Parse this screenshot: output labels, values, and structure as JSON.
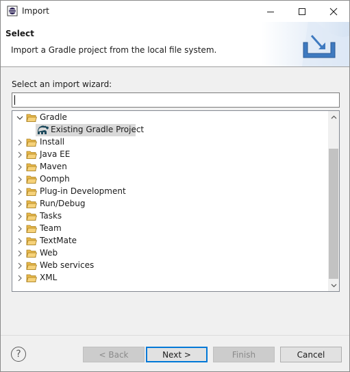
{
  "window": {
    "title": "Import"
  },
  "banner": {
    "title": "Select",
    "description": "Import a Gradle project from the local file system."
  },
  "wizard": {
    "prompt": "Select an import wizard:",
    "filter_value": "",
    "tree": [
      {
        "label": "Gradle",
        "expanded": true,
        "children": [
          {
            "label": "Existing Gradle Project",
            "selected": true
          }
        ]
      },
      {
        "label": "Install",
        "expanded": false
      },
      {
        "label": "Java EE",
        "expanded": false
      },
      {
        "label": "Maven",
        "expanded": false
      },
      {
        "label": "Oomph",
        "expanded": false
      },
      {
        "label": "Plug-in Development",
        "expanded": false
      },
      {
        "label": "Run/Debug",
        "expanded": false
      },
      {
        "label": "Tasks",
        "expanded": false
      },
      {
        "label": "Team",
        "expanded": false
      },
      {
        "label": "TextMate",
        "expanded": false
      },
      {
        "label": "Web",
        "expanded": false
      },
      {
        "label": "Web services",
        "expanded": false
      },
      {
        "label": "XML",
        "expanded": false
      }
    ]
  },
  "footer": {
    "help_symbol": "?",
    "back_label": "< Back",
    "next_label": "Next >",
    "finish_label": "Finish",
    "cancel_label": "Cancel"
  },
  "colors": {
    "folder": "#e8b84a",
    "accent": "#0078d7",
    "selection": "#d9d9d9"
  }
}
